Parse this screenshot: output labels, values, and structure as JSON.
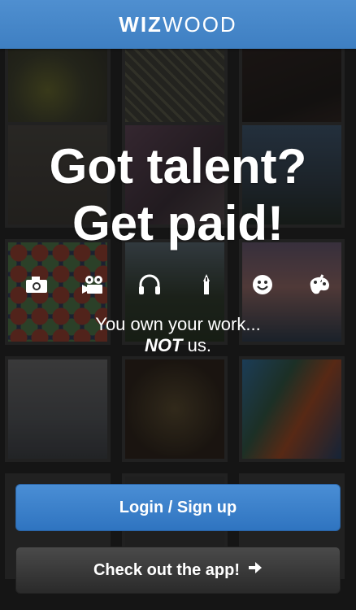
{
  "header": {
    "logo_bold": "WIZ",
    "logo_light": "WOOD"
  },
  "hero": {
    "line1": "Got talent?",
    "line2": "Get paid!"
  },
  "categories": [
    {
      "icon": "camera-icon"
    },
    {
      "icon": "video-camera-icon"
    },
    {
      "icon": "headphones-icon"
    },
    {
      "icon": "pen-icon"
    },
    {
      "icon": "smiley-icon"
    },
    {
      "icon": "palette-icon"
    }
  ],
  "tagline": {
    "line1": "You own your work...",
    "emphasis": "NOT",
    "line2_rest": " us."
  },
  "buttons": {
    "login": "Login / Sign up",
    "app": "Check out the app!"
  },
  "colors": {
    "header_blue": "#4a8ad0",
    "login_blue": "#3b80c8",
    "app_dark": "#353535"
  }
}
